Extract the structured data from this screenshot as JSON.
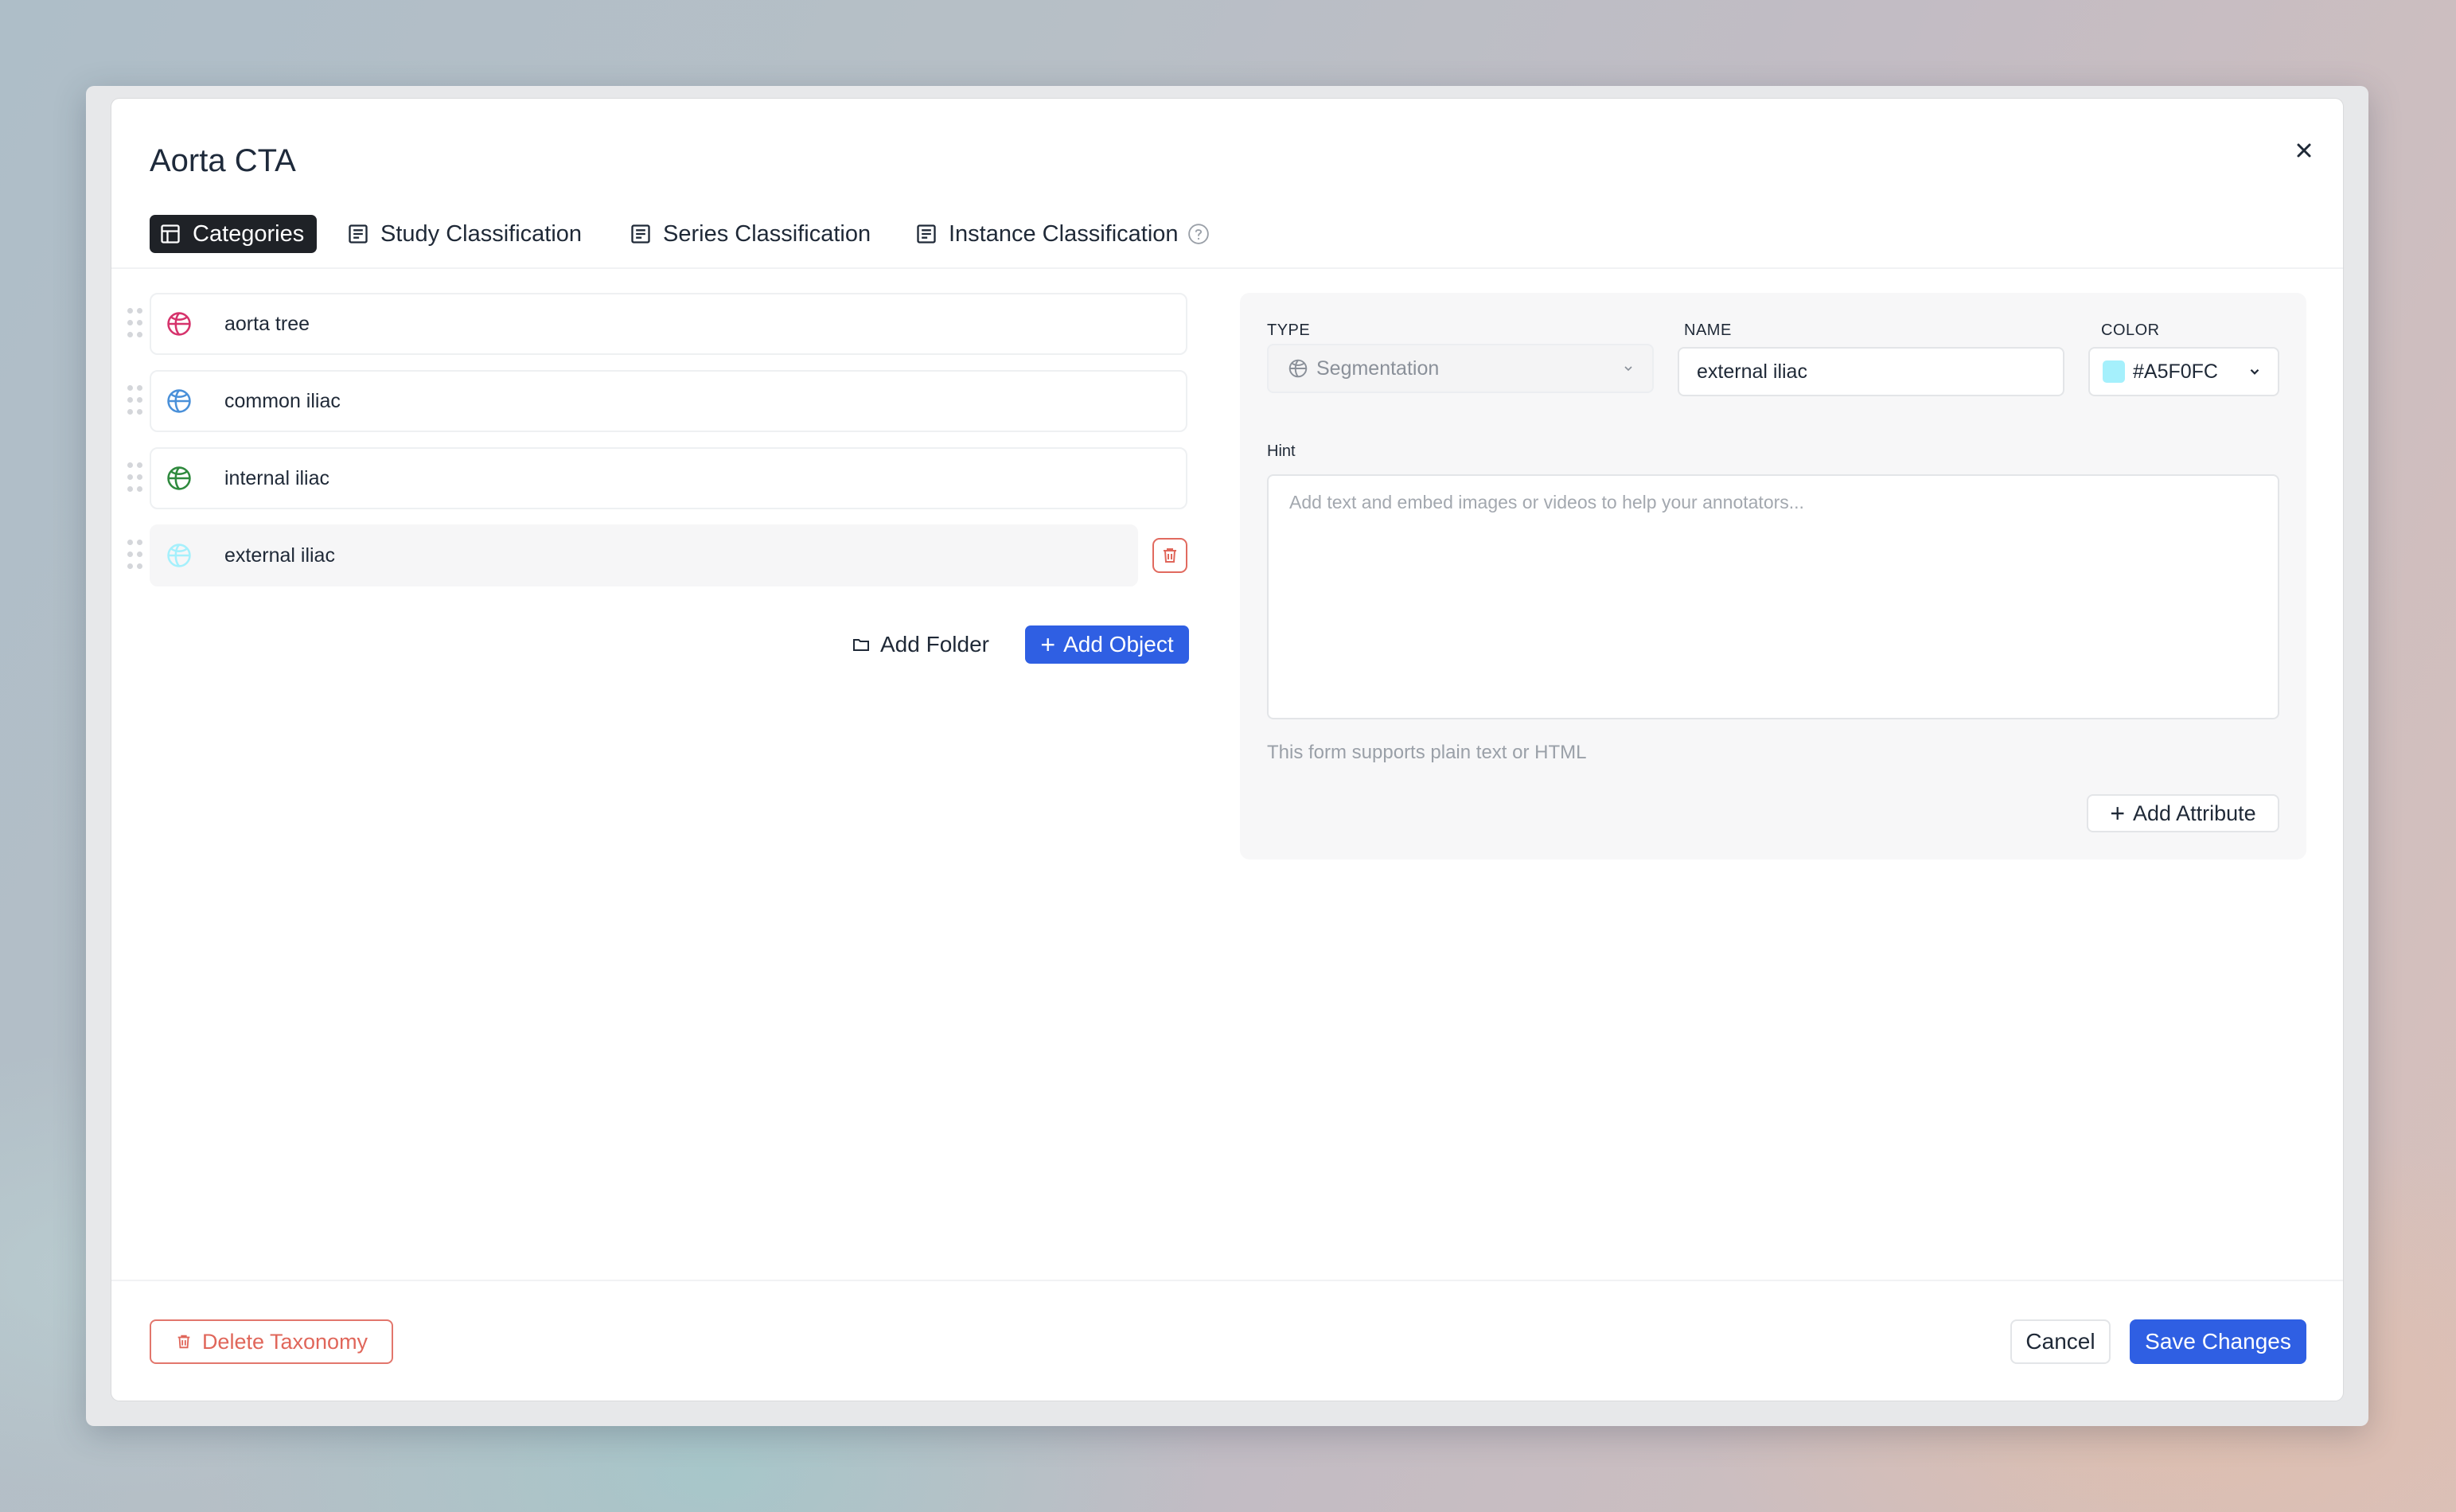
{
  "dialog": {
    "title": "Aorta CTA",
    "close_icon": "close-icon"
  },
  "tabs": [
    {
      "label": "Categories",
      "icon": "layout-icon",
      "active": true
    },
    {
      "label": "Study Classification",
      "icon": "list-icon",
      "active": false
    },
    {
      "label": "Series Classification",
      "icon": "list-icon",
      "active": false
    },
    {
      "label": "Instance Classification",
      "icon": "list-icon",
      "active": false,
      "help_icon": "question-circle-icon"
    }
  ],
  "categories": [
    {
      "label": "aorta tree",
      "icon": "segmentation-icon",
      "color": "#D6336C",
      "selected": false
    },
    {
      "label": "common iliac",
      "icon": "segmentation-icon",
      "color": "#4A90D9",
      "selected": false
    },
    {
      "label": "internal iliac",
      "icon": "segmentation-icon",
      "color": "#2F8A3E",
      "selected": false
    },
    {
      "label": "external iliac",
      "icon": "segmentation-icon",
      "color": "#A5F0FC",
      "selected": true
    }
  ],
  "list_actions": {
    "add_folder": "Add Folder",
    "add_object": "Add Object"
  },
  "editor": {
    "type_label": "TYPE",
    "type_value": "Segmentation",
    "name_label": "NAME",
    "name_value": "external iliac",
    "color_label": "COLOR",
    "color_value": "#A5F0FC",
    "hint_label": "Hint",
    "hint_placeholder": "Add text and embed images or videos to help your annotators...",
    "hint_helper": "This form supports plain text or HTML",
    "add_attribute": "Add Attribute"
  },
  "footer": {
    "delete_taxonomy": "Delete Taxonomy",
    "cancel": "Cancel",
    "save": "Save Changes"
  },
  "colors": {
    "primary": "#2F5FE3",
    "danger": "#E0665A",
    "active_tab_bg": "#1F2227"
  }
}
